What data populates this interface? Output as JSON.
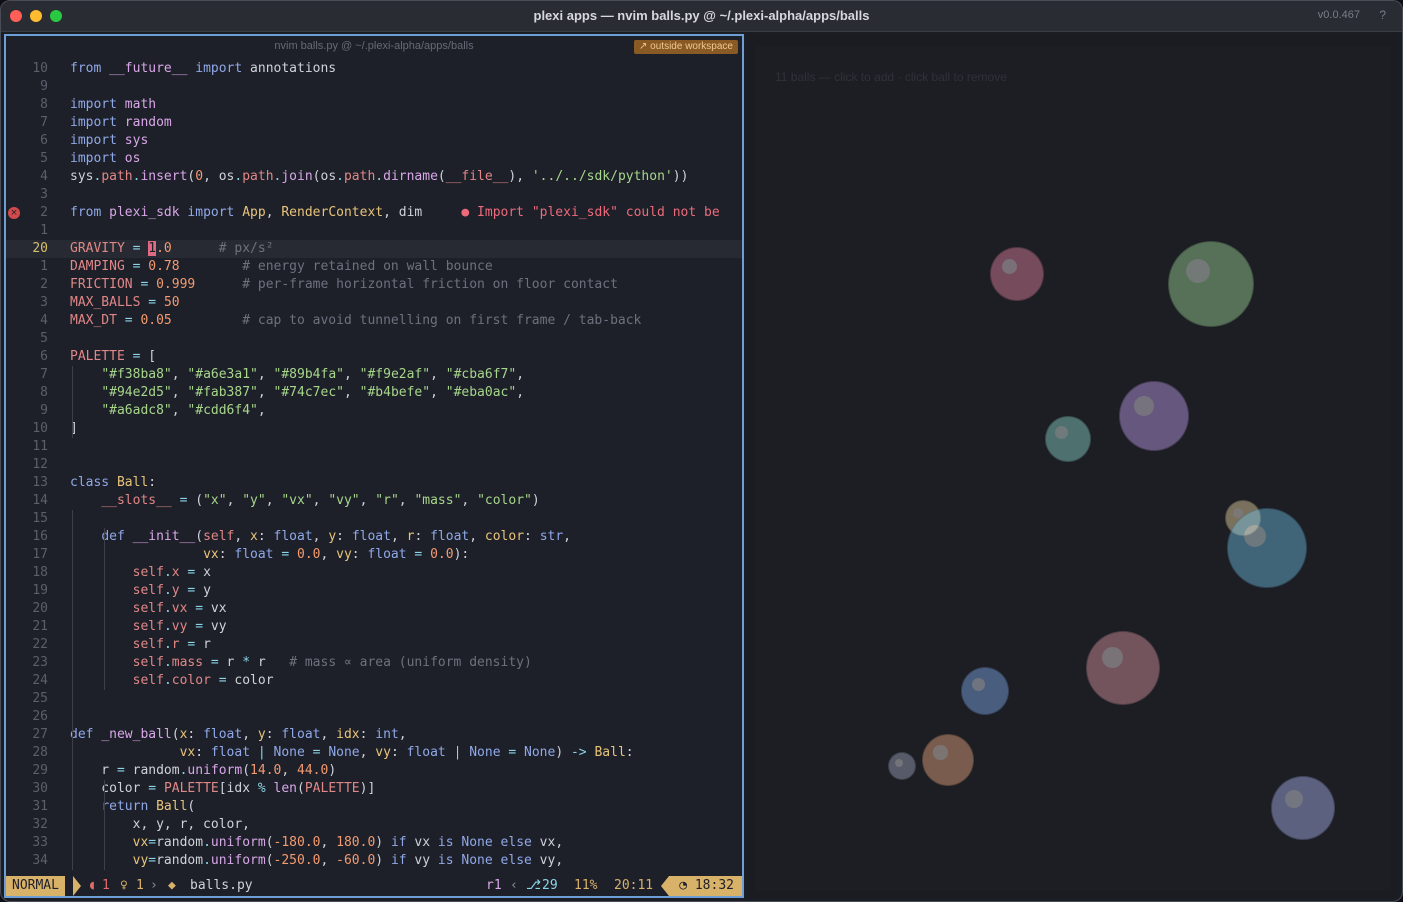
{
  "window": {
    "title": "plexi apps — nvim balls.py @ ~/.plexi-alpha/apps/balls",
    "version": "v0.0.467",
    "help": "?"
  },
  "editor": {
    "path": "nvim balls.py @ ~/.plexi-alpha/apps/balls",
    "badge": "↗ outside workspace",
    "diagnostic_icon": "error-icon"
  },
  "code_lines": [
    {
      "n": "10",
      "html": "<span class='k'>from</span> <span class='f'>__future__</span> <span class='k'>import</span> annotations"
    },
    {
      "n": "9",
      "html": ""
    },
    {
      "n": "8",
      "html": "<span class='k'>import</span> <span class='f'>math</span>"
    },
    {
      "n": "7",
      "html": "<span class='k'>import</span> <span class='f'>random</span>"
    },
    {
      "n": "6",
      "html": "<span class='k'>import</span> <span class='f'>sys</span>"
    },
    {
      "n": "5",
      "html": "<span class='k'>import</span> <span class='f'>os</span>"
    },
    {
      "n": "4",
      "html": "sys<span class='o'>.</span><span class='v'>path</span><span class='o'>.</span><span class='f'>insert</span>(<span class='n'>0</span>, os<span class='o'>.</span><span class='v'>path</span><span class='o'>.</span><span class='f'>join</span>(os<span class='o'>.</span><span class='v'>path</span><span class='o'>.</span><span class='f'>dirname</span>(<span class='v'>__file__</span>), <span class='s'>'../../sdk/python'</span>))"
    },
    {
      "n": "3",
      "html": ""
    },
    {
      "n": "2",
      "html": "<span class='k'>from</span> <span class='f'>plexi_sdk</span> <span class='k'>import</span> <span class='cl'>App</span>, <span class='cl'>RenderContext</span>, dim     <span class='err'>● Import \"plexi_sdk\" could not be</span>",
      "diag": true
    },
    {
      "n": "1",
      "html": ""
    },
    {
      "n": "20",
      "html": "<span class='v'>GRAVITY</span> <span class='o'>=</span> <span class='cursor'>1</span><span class='n'>.0</span>      <span class='c'># px/s²</span>",
      "cur": true
    },
    {
      "n": "1",
      "html": "<span class='v'>DAMPING</span> <span class='o'>=</span> <span class='n'>0.78</span>        <span class='c'># energy retained on wall bounce</span>"
    },
    {
      "n": "2",
      "html": "<span class='v'>FRICTION</span> <span class='o'>=</span> <span class='n'>0.999</span>      <span class='c'># per-frame horizontal friction on floor contact</span>"
    },
    {
      "n": "3",
      "html": "<span class='v'>MAX_BALLS</span> <span class='o'>=</span> <span class='n'>50</span>"
    },
    {
      "n": "4",
      "html": "<span class='v'>MAX_DT</span> <span class='o'>=</span> <span class='n'>0.05</span>         <span class='c'># cap to avoid tunnelling on first frame / tab-back</span>"
    },
    {
      "n": "5",
      "html": ""
    },
    {
      "n": "6",
      "html": "<span class='v'>PALETTE</span> <span class='o'>=</span> ["
    },
    {
      "n": "7",
      "html": "    <span class='s'>\"#f38ba8\"</span>, <span class='s'>\"#a6e3a1\"</span>, <span class='s'>\"#89b4fa\"</span>, <span class='s'>\"#f9e2af\"</span>, <span class='s'>\"#cba6f7\"</span>,"
    },
    {
      "n": "8",
      "html": "    <span class='s'>\"#94e2d5\"</span>, <span class='s'>\"#fab387\"</span>, <span class='s'>\"#74c7ec\"</span>, <span class='s'>\"#b4befe\"</span>, <span class='s'>\"#eba0ac\"</span>,"
    },
    {
      "n": "9",
      "html": "    <span class='s'>\"#a6adc8\"</span>, <span class='s'>\"#cdd6f4\"</span>,"
    },
    {
      "n": "10",
      "html": "]"
    },
    {
      "n": "11",
      "html": ""
    },
    {
      "n": "12",
      "html": ""
    },
    {
      "n": "13",
      "html": "<span class='k'>class</span> <span class='cl'>Ball</span>:"
    },
    {
      "n": "14",
      "html": "    <span class='v'>__slots__</span> <span class='o'>=</span> (<span class='s'>\"x\"</span>, <span class='s'>\"y\"</span>, <span class='s'>\"vx\"</span>, <span class='s'>\"vy\"</span>, <span class='s'>\"r\"</span>, <span class='s'>\"mass\"</span>, <span class='s'>\"color\"</span>)"
    },
    {
      "n": "15",
      "html": ""
    },
    {
      "n": "16",
      "html": "    <span class='k'>def</span> <span class='f'>__init__</span>(<span class='v'>self</span>, <span class='b'>x</span>: <span class='k'>float</span>, <span class='b'>y</span>: <span class='k'>float</span>, <span class='b'>r</span>: <span class='k'>float</span>, <span class='b'>color</span>: <span class='k'>str</span>,"
    },
    {
      "n": "17",
      "html": "                 <span class='b'>vx</span>: <span class='k'>float</span> <span class='o'>=</span> <span class='n'>0.0</span>, <span class='b'>vy</span>: <span class='k'>float</span> <span class='o'>=</span> <span class='n'>0.0</span>):"
    },
    {
      "n": "18",
      "html": "        <span class='v'>self</span><span class='o'>.</span><span class='v'>x</span> <span class='o'>=</span> x"
    },
    {
      "n": "19",
      "html": "        <span class='v'>self</span><span class='o'>.</span><span class='v'>y</span> <span class='o'>=</span> y"
    },
    {
      "n": "20",
      "html": "        <span class='v'>self</span><span class='o'>.</span><span class='v'>vx</span> <span class='o'>=</span> vx"
    },
    {
      "n": "21",
      "html": "        <span class='v'>self</span><span class='o'>.</span><span class='v'>vy</span> <span class='o'>=</span> vy"
    },
    {
      "n": "22",
      "html": "        <span class='v'>self</span><span class='o'>.</span><span class='v'>r</span> <span class='o'>=</span> r"
    },
    {
      "n": "23",
      "html": "        <span class='v'>self</span><span class='o'>.</span><span class='v'>mass</span> <span class='o'>=</span> r <span class='o'>*</span> r   <span class='c'># mass ∝ area (uniform density)</span>"
    },
    {
      "n": "24",
      "html": "        <span class='v'>self</span><span class='o'>.</span><span class='v'>color</span> <span class='o'>=</span> color"
    },
    {
      "n": "25",
      "html": ""
    },
    {
      "n": "26",
      "html": ""
    },
    {
      "n": "27",
      "html": "<span class='k'>def</span> <span class='f'>_new_ball</span>(<span class='b'>x</span>: <span class='k'>float</span>, <span class='b'>y</span>: <span class='k'>float</span>, <span class='b'>idx</span>: <span class='k'>int</span>,"
    },
    {
      "n": "28",
      "html": "              <span class='b'>vx</span>: <span class='k'>float</span> <span class='o'>|</span> <span class='k'>None</span> <span class='o'>=</span> <span class='k'>None</span>, <span class='b'>vy</span>: <span class='k'>float</span> <span class='o'>|</span> <span class='k'>None</span> <span class='o'>=</span> <span class='k'>None</span>) <span class='o'>-></span> <span class='cl'>Ball</span>:"
    },
    {
      "n": "29",
      "html": "    r <span class='o'>=</span> random<span class='o'>.</span><span class='f'>uniform</span>(<span class='n'>14.0</span>, <span class='n'>44.0</span>)"
    },
    {
      "n": "30",
      "html": "    color <span class='o'>=</span> <span class='v'>PALETTE</span>[idx <span class='o'>%</span> <span class='f'>len</span>(<span class='v'>PALETTE</span>)]"
    },
    {
      "n": "31",
      "html": "    <span class='k'>return</span> <span class='cl'>Ball</span>("
    },
    {
      "n": "32",
      "html": "        x, y, r, color,"
    },
    {
      "n": "33",
      "html": "        <span class='b'>vx</span><span class='o'>=</span>random<span class='o'>.</span><span class='f'>uniform</span>(<span class='n'>-180.0</span>, <span class='n'>180.0</span>) <span class='k'>if</span> vx <span class='k'>is</span> <span class='k'>None</span> <span class='k'>else</span> vx,"
    },
    {
      "n": "34",
      "html": "        <span class='b'>vy</span><span class='o'>=</span>random<span class='o'>.</span><span class='f'>uniform</span>(<span class='n'>-250.0</span>, <span class='n'>-60.0</span>) <span class='k'>if</span> vy <span class='k'>is</span> <span class='k'>None</span> <span class='k'>else</span> vy,"
    }
  ],
  "statusbar": {
    "mode": "NORMAL",
    "errors": "1",
    "hints": "1",
    "filename": "balls.py",
    "register": "r1",
    "branch_num": "29",
    "percent": "11%",
    "position": "20:11",
    "clock": "18:32",
    "error_icon": "error-icon",
    "hint_icon": "lightbulb-icon",
    "file_icon": "python-icon",
    "git_icon": "git-icon",
    "clock_icon": "clock-icon"
  },
  "preview": {
    "hint": "11 balls — click to add · click ball to remove",
    "balls": [
      {
        "color": "#f38ba8"
      },
      {
        "color": "#a6e3a1"
      },
      {
        "color": "#94e2d5"
      },
      {
        "color": "#cba6f7"
      },
      {
        "color": "#f9e2af"
      },
      {
        "color": "#74c7ec"
      },
      {
        "color": "#89b4fa"
      },
      {
        "color": "#eba0ac"
      },
      {
        "color": "#a6adc8"
      },
      {
        "color": "#fab387"
      },
      {
        "color": "#b4befe"
      }
    ]
  }
}
